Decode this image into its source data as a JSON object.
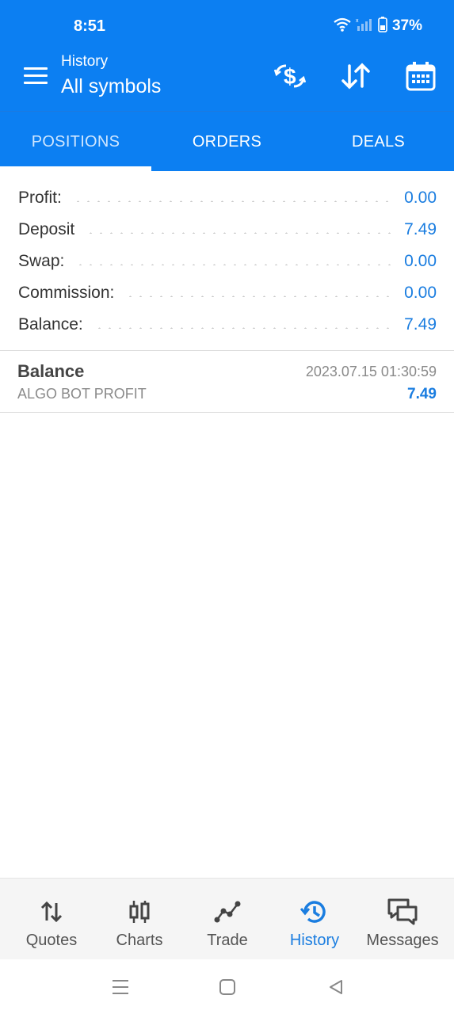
{
  "status_bar": {
    "time": "8:51",
    "battery": "37%"
  },
  "header": {
    "subtitle": "History",
    "title": "All symbols"
  },
  "tabs": [
    {
      "label": "POSITIONS",
      "active": true
    },
    {
      "label": "ORDERS",
      "active": false
    },
    {
      "label": "DEALS",
      "active": false
    }
  ],
  "summary": [
    {
      "label": "Profit:",
      "value": "0.00"
    },
    {
      "label": "Deposit",
      "value": "7.49"
    },
    {
      "label": "Swap:",
      "value": "0.00"
    },
    {
      "label": "Commission:",
      "value": "0.00"
    },
    {
      "label": "Balance:",
      "value": "7.49"
    }
  ],
  "deal": {
    "type": "Balance",
    "comment": "ALGO BOT PROFIT",
    "datetime": "2023.07.15 01:30:59",
    "amount": "7.49"
  },
  "bottom_nav": [
    {
      "label": "Quotes",
      "icon": "quotes-icon",
      "active": false
    },
    {
      "label": "Charts",
      "icon": "charts-icon",
      "active": false
    },
    {
      "label": "Trade",
      "icon": "trade-icon",
      "active": false
    },
    {
      "label": "History",
      "icon": "history-icon",
      "active": true
    },
    {
      "label": "Messages",
      "icon": "messages-icon",
      "active": false
    }
  ],
  "colors": {
    "primary": "#0c7ff2",
    "accent": "#1a7de0",
    "text": "#333333",
    "muted": "#8a8a8a"
  }
}
